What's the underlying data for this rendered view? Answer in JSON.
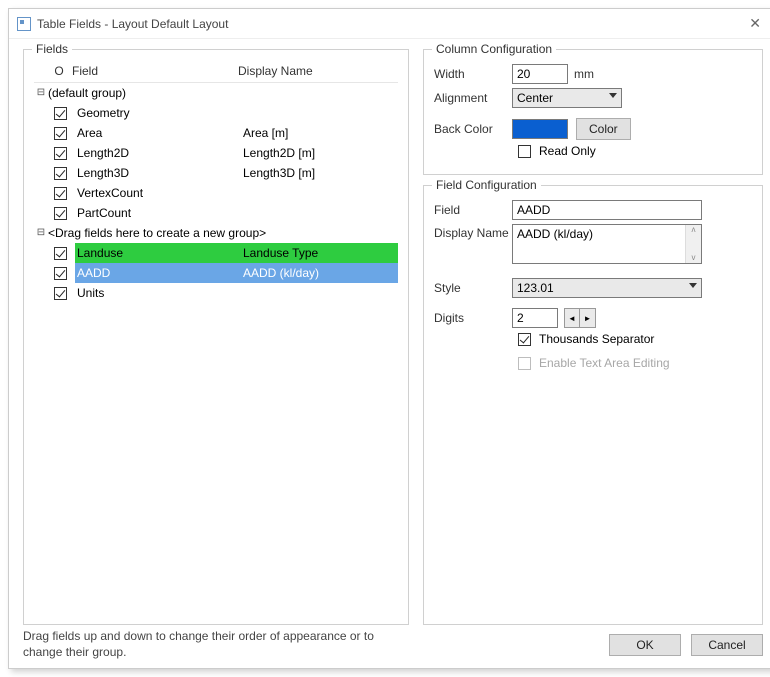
{
  "window": {
    "title": "Table Fields - Layout Default Layout"
  },
  "fields_panel": {
    "legend": "Fields",
    "headers": {
      "o": "O",
      "field": "Field",
      "display": "Display Name"
    },
    "groups": [
      {
        "label": "(default group)",
        "items": [
          {
            "checked": true,
            "field": "Geometry",
            "display": ""
          },
          {
            "checked": true,
            "field": "Area",
            "display": "Area [m]"
          },
          {
            "checked": true,
            "field": "Length2D",
            "display": "Length2D [m]"
          },
          {
            "checked": true,
            "field": "Length3D",
            "display": "Length3D [m]"
          },
          {
            "checked": true,
            "field": "VertexCount",
            "display": ""
          },
          {
            "checked": true,
            "field": "PartCount",
            "display": ""
          }
        ]
      },
      {
        "label": "<Drag fields here to create a new group>",
        "items": [
          {
            "checked": true,
            "field": "Landuse",
            "display": "Landuse Type",
            "highlight": "green"
          },
          {
            "checked": true,
            "field": "AADD",
            "display": "AADD (kl/day)",
            "highlight": "selected"
          },
          {
            "checked": true,
            "field": "Units",
            "display": ""
          }
        ]
      }
    ]
  },
  "column_config": {
    "legend": "Column Configuration",
    "width_label": "Width",
    "width_value": "20",
    "width_unit": "mm",
    "align_label": "Alignment",
    "align_value": "Center",
    "backcolor_label": "Back Color",
    "color_button": "Color",
    "readonly_label": "Read Only",
    "readonly_checked": false,
    "backcolor_hex": "#0a5fd0"
  },
  "field_config": {
    "legend": "Field Configuration",
    "field_label": "Field",
    "field_value": "AADD",
    "dispname_label": "Display Name",
    "dispname_value": "AADD (kl/day)",
    "style_label": "Style",
    "style_value": "123.01",
    "digits_label": "Digits",
    "digits_value": "2",
    "thousands_label": "Thousands Separator",
    "thousands_checked": true,
    "enable_textarea_label": "Enable Text Area Editing"
  },
  "hint": "Drag fields up and down to change their order of appearance or to change their group.",
  "buttons": {
    "ok": "OK",
    "cancel": "Cancel"
  }
}
